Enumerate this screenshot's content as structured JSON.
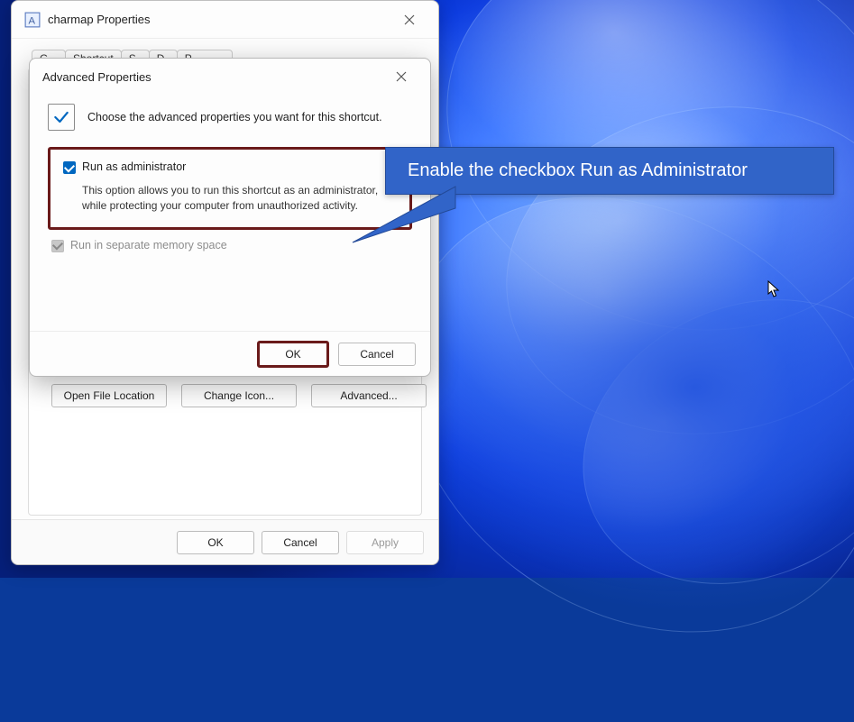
{
  "parent": {
    "title": "charmap Properties",
    "tabs": {
      "general": "General",
      "shortcut": "Shortcut",
      "security": "Security",
      "details": "Details",
      "previous": "Previous Versions"
    },
    "buttons": {
      "open_location": "Open File Location",
      "change_icon": "Change Icon...",
      "advanced": "Advanced..."
    },
    "footer": {
      "ok": "OK",
      "cancel": "Cancel",
      "apply": "Apply"
    }
  },
  "adv": {
    "title": "Advanced Properties",
    "intro": "Choose the advanced properties you want for this shortcut.",
    "run_admin_label": "Run as administrator",
    "run_admin_desc": "This option allows you to run this shortcut as an administrator, while protecting your computer from unauthorized activity.",
    "sep_mem_label": "Run in separate memory space",
    "footer": {
      "ok": "OK",
      "cancel": "Cancel"
    }
  },
  "callout_text": "Enable the checkbox Run as Administrator"
}
